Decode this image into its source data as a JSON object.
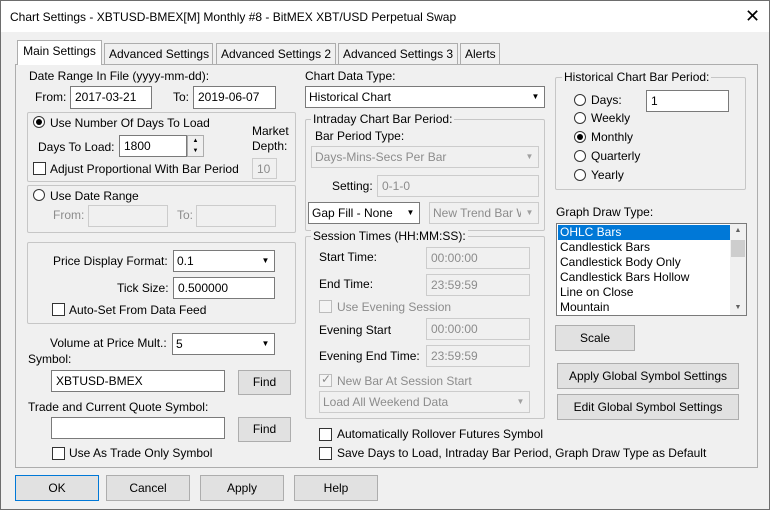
{
  "window": {
    "title": "Chart Settings - XBTUSD-BMEX[M]  Monthly  #8 - BitMEX XBT/USD Perpetual Swap",
    "close_glyph": "✕"
  },
  "tabs": [
    {
      "label": "Main Settings",
      "active": true
    },
    {
      "label": "Advanced Settings",
      "active": false
    },
    {
      "label": "Advanced Settings 2",
      "active": false
    },
    {
      "label": "Advanced Settings 3",
      "active": false
    },
    {
      "label": "Alerts",
      "active": false
    }
  ],
  "date_range": {
    "label": "Date Range In File (yyyy-mm-dd):",
    "from_label": "From:",
    "from_value": "2017-03-21",
    "to_label": "To:",
    "to_value": "2019-06-07"
  },
  "days_group": {
    "use_days_label": "Use Number Of Days To Load",
    "use_days_selected": true,
    "days_to_load_label": "Days To Load:",
    "days_to_load_value": "1800",
    "market_depth_label": "Market\nDepth:",
    "market_depth_value": "10",
    "adjust_label": "Adjust Proportional With Bar Period",
    "adjust_checked": false
  },
  "date_range_group": {
    "use_date_range_label": "Use Date Range",
    "use_date_range_selected": false,
    "from_label": "From:",
    "from_value": "",
    "to_label": "To:",
    "to_value": ""
  },
  "price_group": {
    "price_format_label": "Price Display Format:",
    "price_format_value": "0.1",
    "tick_size_label": "Tick Size:",
    "tick_size_value": "0.500000",
    "auto_set_label": "Auto-Set From Data Feed",
    "auto_set_checked": false
  },
  "volume": {
    "label": "Volume at Price Mult.:",
    "value": "5"
  },
  "symbol": {
    "label": "Symbol:",
    "value": "XBTUSD-BMEX",
    "find_label": "Find"
  },
  "trade_symbol": {
    "label": "Trade and Current Quote Symbol:",
    "value": "",
    "find_label": "Find",
    "trade_only_label": "Use As Trade Only Symbol",
    "trade_only_checked": false
  },
  "chart_data_type": {
    "label": "Chart Data Type:",
    "value": "Historical Chart"
  },
  "intraday": {
    "label": "Intraday Chart Bar Period:",
    "bar_period_type_label": "Bar Period Type:",
    "bar_period_type_value": "Days-Mins-Secs Per Bar",
    "setting_label": "Setting:",
    "setting_value": "0-1-0",
    "gap_fill_value": "Gap Fill - None",
    "new_trend_value": "New Trend Bar W"
  },
  "session": {
    "label": "Session Times (HH:MM:SS):",
    "start_label": "Start Time:",
    "start_value": "00:00:00",
    "end_label": "End Time:",
    "end_value": "23:59:59",
    "use_evening_label": "Use Evening Session",
    "use_evening_checked": false,
    "evening_start_label": "Evening Start",
    "evening_start_value": "00:00:00",
    "evening_end_label": "Evening End Time:",
    "evening_end_value": "23:59:59",
    "new_bar_label": "New Bar At Session Start",
    "new_bar_checked": true,
    "weekend_value": "Load All Weekend Data"
  },
  "rollover_label": "Automatically Rollover Futures Symbol",
  "save_days_label": "Save Days to Load, Intraday Bar Period, Graph Draw Type as Default",
  "historical_period": {
    "label": "Historical Chart Bar Period:",
    "options": [
      {
        "label": "Days:",
        "selected": false
      },
      {
        "label": "Weekly",
        "selected": false
      },
      {
        "label": "Monthly",
        "selected": true
      },
      {
        "label": "Quarterly",
        "selected": false
      },
      {
        "label": "Yearly",
        "selected": false
      }
    ],
    "days_value": "1"
  },
  "graph_draw": {
    "label": "Graph Draw Type:",
    "items": [
      "OHLC Bars",
      "Candlestick Bars",
      "Candlestick Body Only",
      "Candlestick Bars Hollow",
      "Line on Close",
      "Mountain"
    ],
    "selected": "OHLC Bars",
    "scale_label": "Scale"
  },
  "apply_global_label": "Apply Global Symbol Settings",
  "edit_global_label": "Edit Global Symbol Settings",
  "footer": {
    "ok": "OK",
    "cancel": "Cancel",
    "apply": "Apply",
    "help": "Help"
  }
}
